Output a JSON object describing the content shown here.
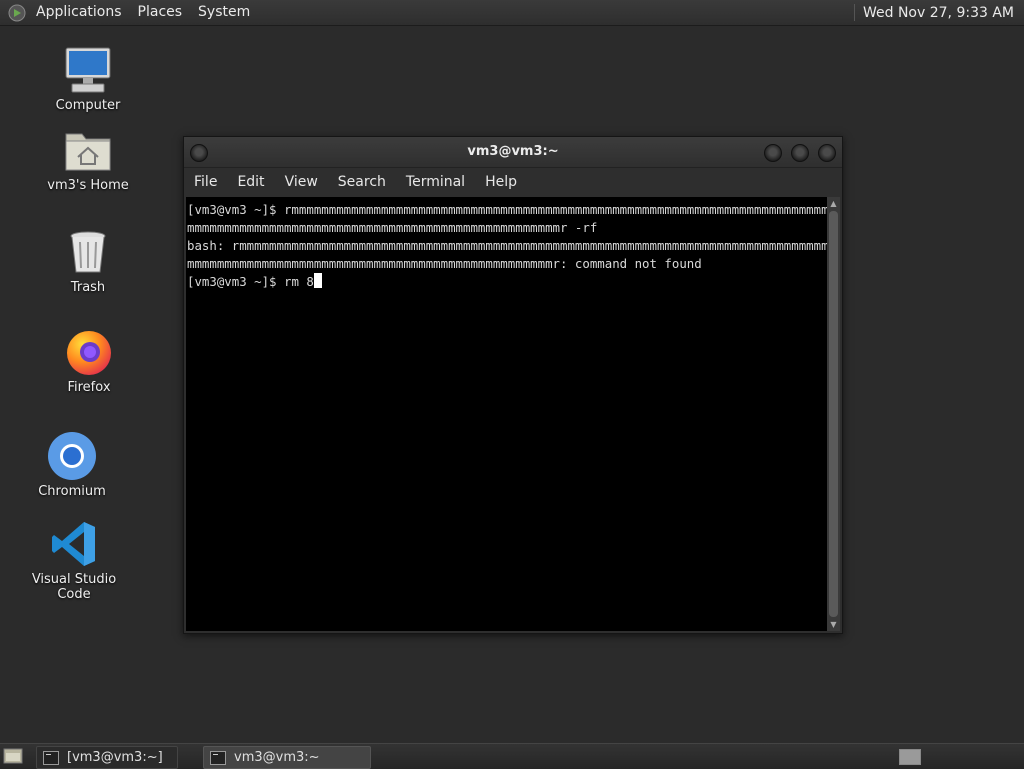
{
  "top_panel": {
    "menus": [
      "Applications",
      "Places",
      "System"
    ],
    "clock": "Wed Nov 27,  9:33 AM"
  },
  "desktop_icons": [
    {
      "label": "Computer",
      "icon": "computer-icon"
    },
    {
      "label": "vm3's Home",
      "icon": "home-folder-icon"
    },
    {
      "label": "Trash",
      "icon": "trash-icon"
    },
    {
      "label": "Firefox",
      "icon": "firefox-icon"
    },
    {
      "label": "Chromium",
      "icon": "chromium-icon"
    },
    {
      "label": "Visual Studio Code",
      "icon": "vscode-icon"
    }
  ],
  "window": {
    "title": "vm3@vm3:~",
    "menu": [
      "File",
      "Edit",
      "View",
      "Search",
      "Terminal",
      "Help"
    ],
    "terminal": {
      "lines": [
        "[vm3@vm3 ~]$ rmmmmmmmmmmmmmmmmmmmmmmmmmmmmmmmmmmmmmmmmmmmmmmmmmmmmmmmmmmmmmmmmmmmmmmmmmmmmmmmmm",
        "mmmmmmmmmmmmmmmmmmmmmmmmmmmmmmmmmmmmmmmmmmmmmmmmmmr -rf",
        "bash: rmmmmmmmmmmmmmmmmmmmmmmmmmmmmmmmmmmmmmmmmmmmmmmmmmmmmmmmmmmmmmmmmmmmmmmmmmmmmmmmmmmmmmmmm",
        "mmmmmmmmmmmmmmmmmmmmmmmmmmmmmmmmmmmmmmmmmmmmmmmmmr: command not found"
      ],
      "prompt": "[vm3@vm3 ~]$ ",
      "current_input": "rm 8"
    }
  },
  "taskbar": {
    "tasks": [
      {
        "label": "[vm3@vm3:~]",
        "active": false
      },
      {
        "label": "vm3@vm3:~",
        "active": true
      }
    ]
  }
}
